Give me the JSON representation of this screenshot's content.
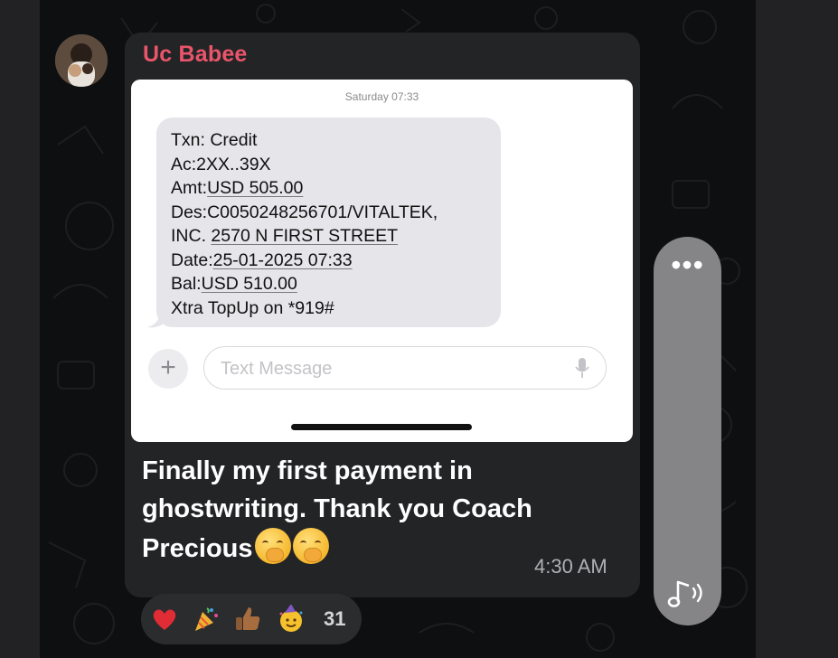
{
  "message": {
    "sender": "Uc Babee",
    "time": "4:30 AM",
    "caption_line1": "Finally my first payment in",
    "caption_line2": "ghostwriting. Thank you Coach",
    "caption_line3": "Precious"
  },
  "screenshot": {
    "timestamp": "Saturday 07:33",
    "sms_lines": [
      {
        "prefix": "Txn: Credit",
        "underlined": ""
      },
      {
        "prefix": "Ac:2XX..39X",
        "underlined": ""
      },
      {
        "prefix": "Amt:",
        "underlined": "USD 505.00"
      },
      {
        "prefix": "Des:C0050248256701/VITALTEK,",
        "underlined": ""
      },
      {
        "prefix": "INC. ",
        "underlined": "2570 N FIRST STREET"
      },
      {
        "prefix": "Date:",
        "underlined": "25-01-2025 07:33"
      },
      {
        "prefix": "Bal:",
        "underlined": "USD 510.00"
      },
      {
        "prefix": "Xtra TopUp on *919#",
        "underlined": ""
      }
    ],
    "input_placeholder": "Text Message",
    "plus_label": "+"
  },
  "reactions": {
    "icons": [
      "red-heart",
      "party-popper",
      "thumbs-up",
      "partying-face"
    ],
    "count": "31"
  },
  "media_controls": {
    "more_label": "•••",
    "audio_icon": "music-note-sound"
  },
  "colors": {
    "sender_name": "#e9556a",
    "bubble_bg": "#232426",
    "sms_bubble": "#e5e5ea"
  }
}
